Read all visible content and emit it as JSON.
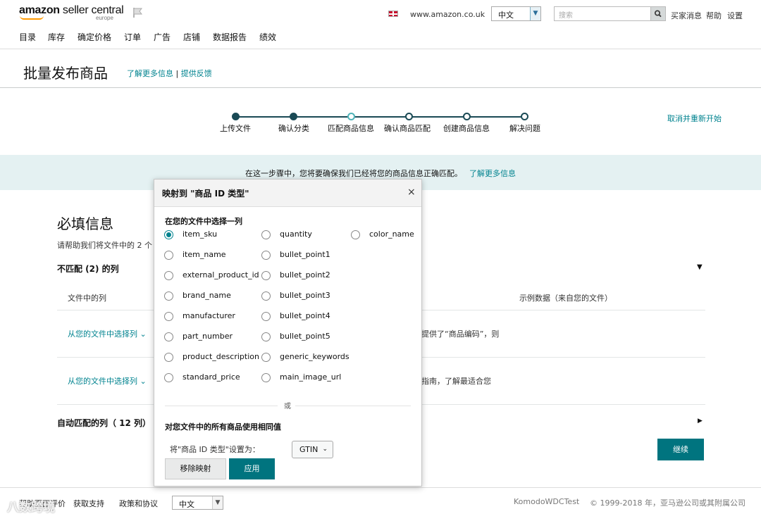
{
  "header": {
    "logo_bold": "amazon",
    "logo_light": " seller central",
    "logo_region": "europe",
    "domain": "www.amazon.co.uk",
    "language": "中文",
    "search_placeholder": "搜索",
    "links": [
      "买家消息",
      "帮助",
      "设置"
    ],
    "nav": [
      "目录",
      "库存",
      "确定价格",
      "订单",
      "广告",
      "店铺",
      "数据报告",
      "绩效"
    ]
  },
  "title_bar": {
    "title": "批量发布商品",
    "learn_more": "了解更多信息",
    "separator": "|",
    "feedback": "提供反馈"
  },
  "steps": {
    "items": [
      {
        "label": "上传文件",
        "state": "done"
      },
      {
        "label": "确认分类",
        "state": "done"
      },
      {
        "label": "匹配商品信息",
        "state": "current"
      },
      {
        "label": "确认商品匹配",
        "state": "todo"
      },
      {
        "label": "创建商品信息",
        "state": "todo"
      },
      {
        "label": "解决问题",
        "state": "todo"
      }
    ],
    "cancel": "取消并重新开始"
  },
  "info": {
    "text": "在这一步骤中，您将要确保我们已经将您的商品信息正确匹配。",
    "link": "了解更多信息"
  },
  "main": {
    "required_title": "必填信息",
    "required_help": "请帮助我们将文件中的 2 个",
    "unmatched_title": "不匹配 (2) 的列",
    "col_file": "文件中的列",
    "col_sample": "示例数据（来自您的文件）",
    "rows": [
      {
        "choose": "从您的文件中选择列",
        "text": "提供了“商品编码”，则"
      },
      {
        "choose": "从您的文件中选择列",
        "text": "指南，了解最适合您"
      }
    ],
    "auto_title": "自动匹配的列（ 12 列）",
    "continue": "继续"
  },
  "modal": {
    "title": "映射到 \"商品 ID 类型\"",
    "close": "×",
    "choose_col": "在您的文件中选择一列",
    "options_col1": [
      "item_sku",
      "item_name",
      "external_product_id",
      "brand_name",
      "manufacturer",
      "part_number",
      "product_description",
      "standard_price"
    ],
    "options_col2": [
      "quantity",
      "bullet_point1",
      "bullet_point2",
      "bullet_point3",
      "bullet_point4",
      "bullet_point5",
      "generic_keywords",
      "main_image_url"
    ],
    "options_col3": [
      "color_name"
    ],
    "selected": "item_sku",
    "or": "或",
    "same_value": "对您文件中的所有商品使用相同值",
    "set_label": "将\"商品 ID 类型\"设置为：",
    "set_value": "GTIN",
    "remove": "移除映射",
    "apply": "应用"
  },
  "footer": {
    "items": [
      "帮助页面评价",
      "获取支持",
      "政策和协议"
    ],
    "language": "中文",
    "account": "KomodoWDCTest",
    "copyright": "© 1999-2018 年，亚马逊公司或其附属公司",
    "watermark": "八数跨境"
  },
  "colors": {
    "accent": "#00838f",
    "button": "#00747f",
    "info_band": "#e4f1f2",
    "step_dark": "#1a4a55"
  }
}
